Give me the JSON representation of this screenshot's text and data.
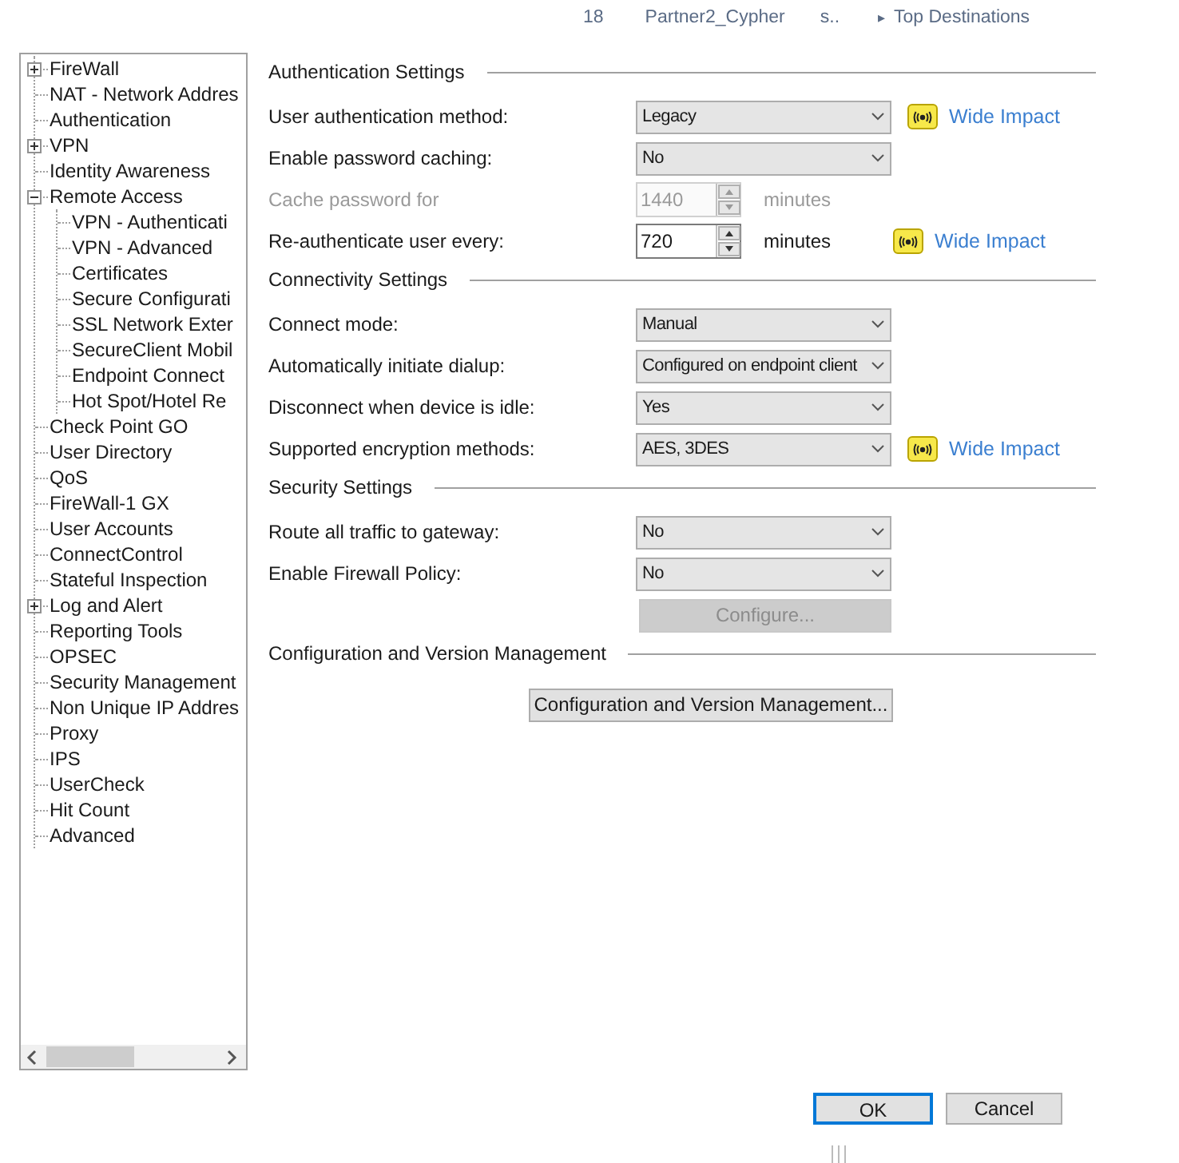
{
  "top_strip": {
    "number": "18",
    "name": "Partner2_Cypher",
    "column_3": "s..",
    "arrow": "▸",
    "link": "Top Destinations"
  },
  "tree": [
    {
      "label": "FireWall",
      "expanded": false
    },
    {
      "label": "NAT - Network Addres"
    },
    {
      "label": "Authentication"
    },
    {
      "label": "VPN",
      "expanded": false
    },
    {
      "label": "Identity Awareness"
    },
    {
      "label": "Remote Access",
      "expanded": true,
      "children": [
        {
          "label": "VPN - Authenticati"
        },
        {
          "label": "VPN - Advanced"
        },
        {
          "label": "Certificates"
        },
        {
          "label": "Secure Configurati"
        },
        {
          "label": "SSL Network Exter"
        },
        {
          "label": "SecureClient Mobil"
        },
        {
          "label": "Endpoint Connect"
        },
        {
          "label": "Hot Spot/Hotel Re"
        }
      ]
    },
    {
      "label": "Check Point GO"
    },
    {
      "label": "User Directory"
    },
    {
      "label": "QoS"
    },
    {
      "label": "FireWall-1 GX"
    },
    {
      "label": "User Accounts"
    },
    {
      "label": "ConnectControl"
    },
    {
      "label": "Stateful Inspection"
    },
    {
      "label": "Log and Alert",
      "expanded": false
    },
    {
      "label": "Reporting Tools"
    },
    {
      "label": "OPSEC"
    },
    {
      "label": "Security Management"
    },
    {
      "label": "Non Unique IP Addres"
    },
    {
      "label": "Proxy"
    },
    {
      "label": "IPS"
    },
    {
      "label": "UserCheck"
    },
    {
      "label": "Hit Count"
    },
    {
      "label": "Advanced"
    }
  ],
  "sections": [
    {
      "title": "Authentication Settings",
      "rows": [
        {
          "kind": "select",
          "label": "User authentication method:",
          "value": "Legacy",
          "disabled": false,
          "impact": "Wide Impact"
        },
        {
          "kind": "select",
          "label": "Enable password caching:",
          "value": "No",
          "disabled": false
        },
        {
          "kind": "spinner",
          "label": "Cache password for",
          "value": "1440",
          "unit": "minutes",
          "disabled": true
        },
        {
          "kind": "spinner",
          "label": "Re-authenticate user every:",
          "value": "720",
          "unit": "minutes",
          "disabled": false,
          "impact": "Wide Impact"
        }
      ]
    },
    {
      "title": "Connectivity Settings",
      "rows": [
        {
          "kind": "select",
          "label": "Connect mode:",
          "value": "Manual",
          "disabled": false
        },
        {
          "kind": "select",
          "label": "Automatically initiate dialup:",
          "value": "Configured on endpoint client",
          "disabled": false
        },
        {
          "kind": "select",
          "label": "Disconnect when device is idle:",
          "value": "Yes",
          "disabled": false
        },
        {
          "kind": "select",
          "label": "Supported encryption methods:",
          "value": "AES, 3DES",
          "disabled": false,
          "impact": "Wide Impact"
        }
      ]
    },
    {
      "title": "Security Settings",
      "rows": [
        {
          "kind": "select",
          "label": "Route all traffic to gateway:",
          "value": "No",
          "disabled": false
        },
        {
          "kind": "select",
          "label": "Enable Firewall Policy:",
          "value": "No",
          "disabled": false
        },
        {
          "kind": "button",
          "label": "Configure...",
          "disabled": true
        }
      ]
    },
    {
      "title": "Configuration and Version Management",
      "rows": [
        {
          "kind": "wide_button",
          "label": "Configuration and Version Management...",
          "disabled": false
        }
      ]
    }
  ],
  "buttons": [
    {
      "label": "OK",
      "default": true
    },
    {
      "label": "Cancel",
      "default": false
    }
  ]
}
